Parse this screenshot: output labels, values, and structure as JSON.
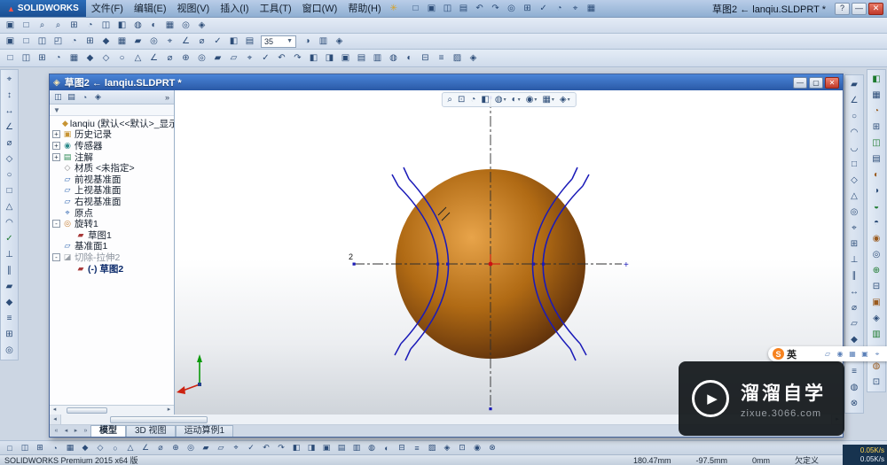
{
  "colors": {
    "sphere_hi": "#e8a44a",
    "sphere_mid": "#b06a14",
    "sphere_lo": "#54290a",
    "sketch_blue": "#1a1ab8",
    "accent_red": "#cc1111"
  },
  "titlebar": {
    "brand": "SOLIDWORKS",
    "menus": [
      "文件(F)",
      "编辑(E)",
      "视图(V)",
      "插入(I)",
      "工具(T)",
      "窗口(W)",
      "帮助(H)"
    ],
    "doc": "草图2 ← lanqiu.SLDPRT *",
    "controls": [
      "?",
      "—",
      "✕"
    ]
  },
  "child": {
    "title": "草图2 ← lanqiu.SLDPRT *",
    "controls": [
      "—",
      "▢",
      "✕"
    ]
  },
  "toolbars": {
    "titlebar": [
      "□",
      "▣",
      "◫",
      "▤",
      "↶",
      "↷",
      "◎",
      "⊞",
      "✓",
      "◔",
      "⌖",
      "▦"
    ],
    "row2": [
      "▣",
      "□",
      "⌕",
      "⌕",
      "⊞",
      "◔",
      "◫",
      "◧",
      "◍",
      "◐",
      "▦",
      "◎",
      "◈"
    ],
    "row3": [
      "▣",
      "□",
      "◫",
      "◰",
      "◔",
      "⊞",
      "◆",
      "▦",
      "▰",
      "◎",
      "⌖",
      "∠",
      "⌀",
      "✓",
      "◧",
      "▤"
    ],
    "combo": "35",
    "row3b": [
      "◑",
      "▥",
      "◈"
    ],
    "row4": [
      "□",
      "◫",
      "⊞",
      "◔",
      "▦",
      "◆",
      "◇",
      "○",
      "△",
      "∠",
      "⌀",
      "⊕",
      "◎",
      "▰",
      "▱",
      "⌖",
      "✓",
      "↶",
      "↷",
      "◧",
      "◨",
      "▣",
      "▤",
      "▥",
      "◍",
      "◐",
      "⊟",
      "≡",
      "▨",
      "◈"
    ],
    "left_strip": [
      "⌖",
      "↕",
      "↔",
      "∠",
      "⌀",
      "◇",
      "○",
      "□",
      "△",
      "◠",
      "✓",
      "⊥",
      "∥",
      "▰",
      "◆",
      "≡",
      "⊞",
      "◎"
    ],
    "right_inner": [
      "▰",
      "∠",
      "○",
      "◠",
      "◡",
      "□",
      "◇",
      "△",
      "◎",
      "⌖",
      "⊞",
      "⊥",
      "∥",
      "↔",
      "⌀",
      "▱",
      "◆",
      "✓",
      "≡",
      "◍",
      "⊗"
    ],
    "right_outer": [
      "◧",
      "▦",
      "◔",
      "⊞",
      "◫",
      "▤",
      "◐",
      "◑",
      "◒",
      "◓",
      "◉",
      "◎",
      "⊕",
      "⊟",
      "▣",
      "◈",
      "▥",
      "▨",
      "◍",
      "⊡"
    ],
    "bottom": [
      "□",
      "◫",
      "⊞",
      "◔",
      "▦",
      "◆",
      "◇",
      "○",
      "△",
      "∠",
      "⌀",
      "⊕",
      "◎",
      "▰",
      "▱",
      "⌖",
      "✓",
      "↶",
      "↷",
      "◧",
      "◨",
      "▣",
      "▤",
      "▥",
      "◍",
      "◐",
      "⊟",
      "≡",
      "▨",
      "◈",
      "⊡",
      "◉",
      "⊗"
    ],
    "panel_tabs": [
      "◫",
      "▤",
      "◔",
      "◈"
    ],
    "panel_chevron": "»",
    "hud": [
      {
        "g": "⌕",
        "dd": false
      },
      {
        "g": "⊡",
        "dd": false
      },
      {
        "g": "◔",
        "dd": false
      },
      {
        "g": "◧",
        "dd": false
      },
      {
        "g": "◍",
        "dd": true
      },
      {
        "g": "◐",
        "dd": true
      },
      {
        "g": "◉",
        "dd": true
      },
      {
        "g": "▦",
        "dd": true
      },
      {
        "g": "◈",
        "dd": true
      }
    ]
  },
  "tree": [
    {
      "label": "lanqiu (默认<<默认>_显示状",
      "icon": "part",
      "exp": "",
      "lvl": 0
    },
    {
      "label": "历史记录",
      "icon": "history",
      "exp": "+",
      "lvl": 0
    },
    {
      "label": "传感器",
      "icon": "sensors",
      "exp": "+",
      "lvl": 0
    },
    {
      "label": "注解",
      "icon": "annotations",
      "exp": "+",
      "lvl": 0
    },
    {
      "label": "材质 <未指定>",
      "icon": "material",
      "exp": "",
      "lvl": 0
    },
    {
      "label": "前视基准面",
      "icon": "plane",
      "exp": "",
      "lvl": 0
    },
    {
      "label": "上视基准面",
      "icon": "plane",
      "exp": "",
      "lvl": 0
    },
    {
      "label": "右视基准面",
      "icon": "plane",
      "exp": "",
      "lvl": 0
    },
    {
      "label": "原点",
      "icon": "origin",
      "exp": "",
      "lvl": 0
    },
    {
      "label": "旋转1",
      "icon": "revolve",
      "exp": "-",
      "lvl": 0
    },
    {
      "label": "草图1",
      "icon": "sketch",
      "exp": "",
      "lvl": 1
    },
    {
      "label": "基准面1",
      "icon": "plane",
      "exp": "",
      "lvl": 0
    },
    {
      "label": "切除-拉伸2",
      "icon": "cut",
      "exp": "-",
      "lvl": 0,
      "muted": true
    },
    {
      "label": "(-) 草图2",
      "icon": "sketch",
      "exp": "",
      "lvl": 1,
      "active": true
    }
  ],
  "tabs": {
    "items": [
      "模型",
      "3D 视图",
      "运动算例1"
    ],
    "active": 0
  },
  "sketch": {
    "dim_label": "2",
    "plus_label": "+"
  },
  "statusbar": {
    "product": "SOLIDWORKS Premium 2015 x64 版",
    "x": "180.47mm",
    "y": "-97.5mm",
    "z": "0mm",
    "state": "欠定义"
  },
  "watermark": {
    "brand": "溜溜自学",
    "site": "zixue.3066.com",
    "play_glyph": "▶"
  },
  "ime": {
    "logo": "S",
    "lang": "英",
    "icons": [
      "▱",
      "◉",
      "▦",
      "▣",
      "⌖"
    ]
  },
  "netspeed": {
    "up": "0.05K/s",
    "down": "0.05K/s"
  }
}
